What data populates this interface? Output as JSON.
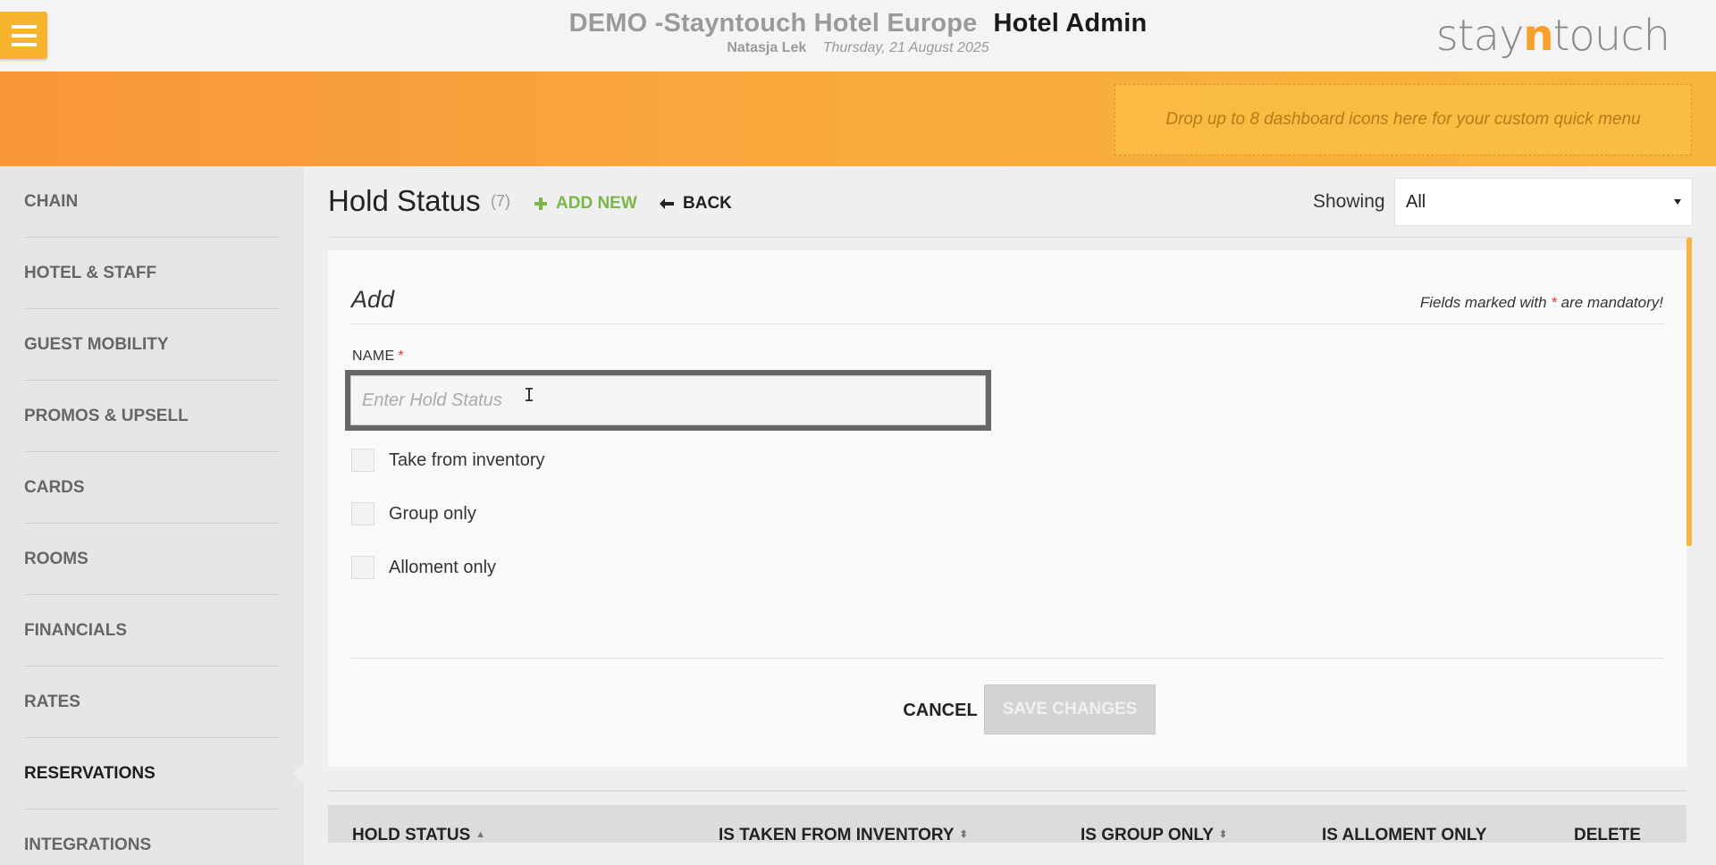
{
  "header": {
    "hotel_name": "DEMO -Stayntouch Hotel Europe",
    "app_name": "Hotel Admin",
    "user": "Natasja Lek",
    "date": "Thursday, 21 August 2025",
    "logo_pre": "stay",
    "logo_n": "n",
    "logo_post": "touch"
  },
  "quick_menu": {
    "placeholder": "Drop up to 8 dashboard icons here for your custom quick menu"
  },
  "sidebar": {
    "items": [
      {
        "label": "CHAIN"
      },
      {
        "label": "HOTEL & STAFF"
      },
      {
        "label": "GUEST MOBILITY"
      },
      {
        "label": "PROMOS & UPSELL"
      },
      {
        "label": "CARDS"
      },
      {
        "label": "ROOMS"
      },
      {
        "label": "FINANCIALS"
      },
      {
        "label": "RATES"
      },
      {
        "label": "RESERVATIONS"
      },
      {
        "label": "INTEGRATIONS"
      }
    ],
    "active": "RESERVATIONS"
  },
  "page": {
    "title": "Hold Status",
    "count": "(7)",
    "add_new": "ADD NEW",
    "back": "BACK",
    "showing_label": "Showing",
    "showing_value": "All"
  },
  "form": {
    "heading": "Add",
    "mandatory_pre": "Fields marked with",
    "mandatory_star": "*",
    "mandatory_post": "are mandatory!",
    "name_label": "NAME",
    "name_star": "*",
    "name_placeholder": "Enter Hold Status",
    "name_value": "",
    "checkboxes": [
      {
        "label": "Take from inventory",
        "checked": false
      },
      {
        "label": "Group only",
        "checked": false
      },
      {
        "label": "Alloment only",
        "checked": false
      }
    ],
    "cancel": "CANCEL",
    "save": "SAVE CHANGES"
  },
  "table": {
    "columns": [
      {
        "label": "HOLD STATUS",
        "sort": "▲"
      },
      {
        "label": "IS TAKEN FROM INVENTORY",
        "sort": "⬍"
      },
      {
        "label": "IS GROUP ONLY",
        "sort": "⬍"
      },
      {
        "label": "IS ALLOMENT ONLY",
        "sort": ""
      },
      {
        "label": "DELETE",
        "sort": ""
      }
    ]
  },
  "colors": {
    "accent_orange": "#f7a02a",
    "add_new_green": "#7ab648",
    "menu_button": "#f6b52d"
  },
  "icons": {
    "menu": "hamburger-icon",
    "add": "plus-icon",
    "back": "arrow-left-icon",
    "select": "caret-down-icon"
  }
}
